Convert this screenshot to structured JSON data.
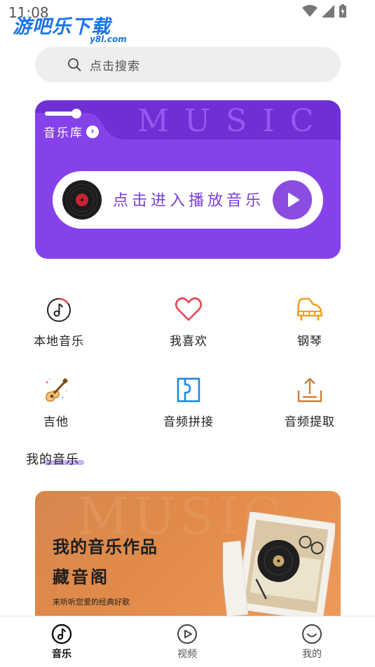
{
  "status_bar": {
    "time": "11:08"
  },
  "watermark": {
    "brand": "游吧乐下载",
    "domain": "y8l.com"
  },
  "search": {
    "placeholder": "点击搜索"
  },
  "music_card": {
    "watermark": "MUSIC",
    "library_label": "音乐库",
    "play_text": "点击进入播放音乐",
    "colors": {
      "card": "#8542ea",
      "accent": "#7a3fd8"
    }
  },
  "features": [
    {
      "label": "本地音乐",
      "icon": "music-note-icon"
    },
    {
      "label": "我喜欢",
      "icon": "heart-icon"
    },
    {
      "label": "钢琴",
      "icon": "piano-icon"
    },
    {
      "label": "吉他",
      "icon": "guitar-icon"
    },
    {
      "label": "音频拼接",
      "icon": "audio-splice-icon"
    },
    {
      "label": "音频提取",
      "icon": "audio-extract-icon"
    }
  ],
  "my_music": {
    "title": "我的音乐",
    "card": {
      "watermark": "MUSIC",
      "title": "我的音乐作品",
      "subtitle": "藏音阁",
      "description": "来听听您爱的经典好歌"
    }
  },
  "bottom_nav": [
    {
      "label": "音乐",
      "icon": "music-disc-icon",
      "active": true
    },
    {
      "label": "视频",
      "icon": "play-circle-icon",
      "active": false
    },
    {
      "label": "我的",
      "icon": "smile-icon",
      "active": false
    }
  ]
}
